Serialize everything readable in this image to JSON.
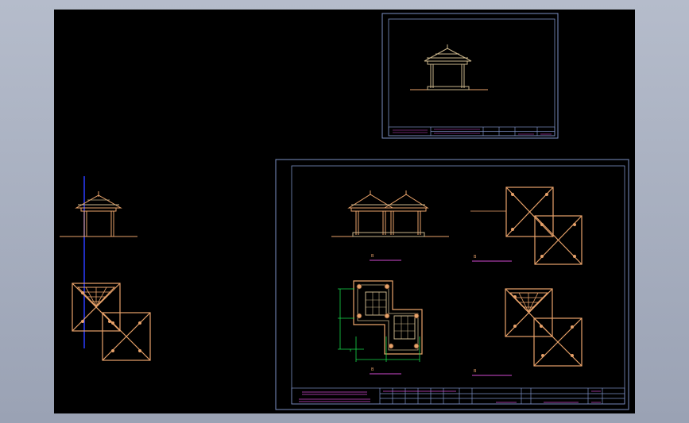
{
  "app": {
    "title": ""
  },
  "colors": {
    "background": "#000000",
    "frame": "#7b8fc4",
    "drawing_orange": "#e8a26a",
    "dimension_green": "#17d84a",
    "label_magenta": "#d04ad0",
    "axis_blue": "#2a3cff",
    "tan": "#c9b48a"
  },
  "sheet_main": {
    "plan_labels": [
      "B",
      "B",
      "B",
      "B"
    ]
  },
  "icons": [
    "pavilion-elevation-icon",
    "hip-roof-plan-icon",
    "floor-plan-icon"
  ]
}
